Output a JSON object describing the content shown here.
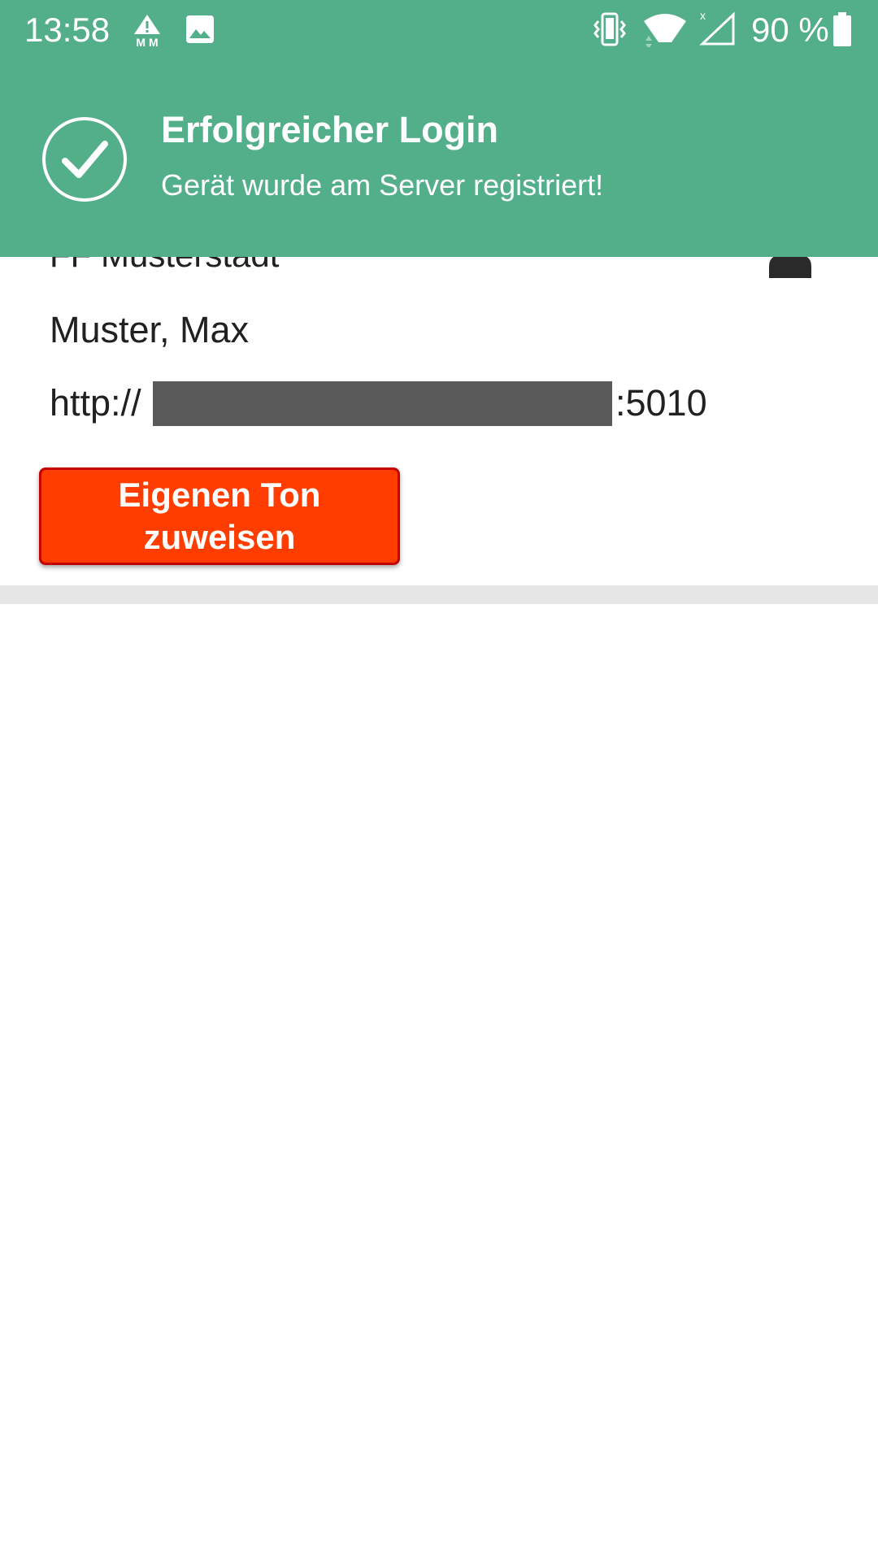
{
  "status_bar": {
    "time": "13:58",
    "battery": "90 %",
    "icons": [
      "alert-mm-icon",
      "image-icon",
      "vibrate-icon",
      "wifi-icon",
      "signal-no-service-icon",
      "battery-icon"
    ]
  },
  "toast": {
    "icon": "check-circle-icon",
    "title": "Erfolgreicher Login",
    "message": "Gerät wurde am Server registriert!"
  },
  "account": {
    "station": "FF Musterstadt",
    "user": "Muster, Max",
    "url_prefix": "http://",
    "url_suffix": ":5010",
    "icon": "user-icon"
  },
  "actions": {
    "assign_tone_label": "Eigenen Ton zuweisen"
  },
  "colors": {
    "banner": "#53ae8a",
    "button": "#ff3d00",
    "button_border": "#c40000",
    "divider": "#e6e6e6",
    "redaction": "#5a5a5a"
  }
}
